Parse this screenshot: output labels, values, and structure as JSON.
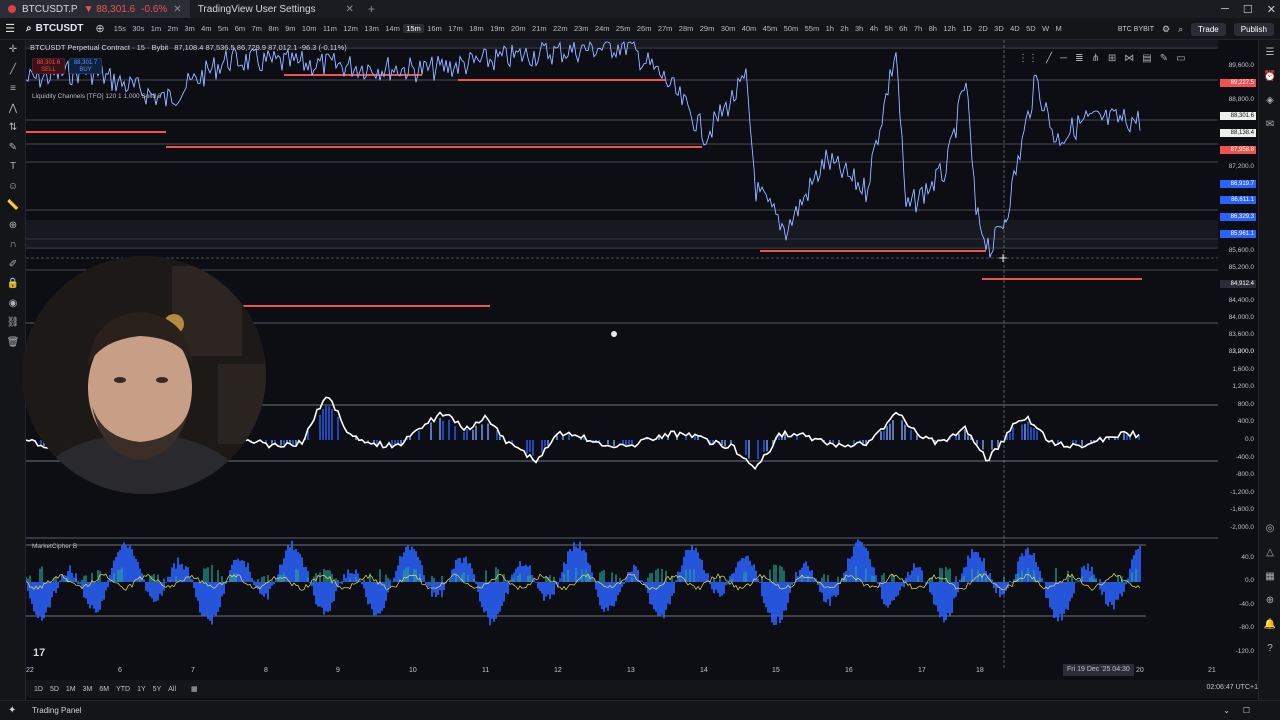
{
  "tabs": [
    {
      "label": "BTCUSDT.P",
      "price": "▼ 88,301.6",
      "change": "-0.6%"
    },
    {
      "label": "TradingView User Settings"
    }
  ],
  "toolbar": {
    "symbol": "BTCUSDT",
    "timeframes": [
      "15s",
      "30s",
      "1m",
      "2m",
      "3m",
      "4m",
      "5m",
      "6m",
      "7m",
      "8m",
      "9m",
      "10m",
      "11m",
      "12m",
      "13m",
      "14m",
      "15m",
      "16m",
      "17m",
      "18m",
      "19m",
      "20m",
      "21m",
      "22m",
      "23m",
      "24m",
      "25m",
      "26m",
      "27m",
      "28m",
      "29m",
      "30m",
      "40m",
      "45m",
      "50m",
      "55m",
      "1h",
      "2h",
      "3h",
      "4h",
      "5h",
      "6h",
      "7h",
      "8h",
      "12h",
      "1D",
      "2D",
      "3D",
      "4D",
      "5D",
      "W",
      "M"
    ],
    "selected_timeframe": "15m",
    "account": "BTC BYBIT",
    "trade_label": "Trade",
    "publish_label": "Publish"
  },
  "chart_header": {
    "title": "BTCUSDT Perpetual Contract · 15 · Bybit",
    "ohlc": "87,108.4  87,536.5  86,729.9  87,012.1  -96.3 (-0.11%)",
    "sell_price": "88,301.6",
    "sell_label": "SELL",
    "buy_price": "88,301.7",
    "buy_label": "BUY",
    "indicator1": "Liquidity Channels [TFO] 120 1 1,000 Solid 3",
    "indicator3": "MarketCipher B"
  },
  "price_axis": [
    "89,600.0",
    "89,227.5",
    "88,800.0",
    "88,301.6",
    "88,138.4",
    "87,958.8",
    "87,200.0",
    "86,919.7",
    "86,611.1",
    "86,329.3",
    "85,961.1",
    "85,600.0",
    "85,200.0",
    "84,912.4",
    "84,400.0",
    "84,000.0",
    "83,600.0",
    "83,200.0"
  ],
  "osc_axis": [
    "2,000.0",
    "1,600.0",
    "1,200.0",
    "800.0",
    "400.0",
    "0.0",
    "-400.0",
    "-800.0",
    "-1,200.0",
    "-1,600.0",
    "-2,000.0"
  ],
  "mcb_axis": [
    "40.0",
    "0.0",
    "-40.0",
    "-80.0",
    "-120.0"
  ],
  "time_axis": [
    "6",
    "7",
    "8",
    "9",
    "10",
    "11",
    "12",
    "13",
    "14",
    "15",
    "16",
    "17",
    "18",
    "Fri 19 Dec '25  04:30",
    "20",
    "21",
    "22"
  ],
  "ranges": [
    "1D",
    "5D",
    "1M",
    "3M",
    "6M",
    "YTD",
    "1Y",
    "5Y",
    "All"
  ],
  "clock": "02:06:47 UTC+1",
  "trading_panel": "Trading Panel",
  "colors": {
    "bg": "#0c0e13",
    "red": "#ef5350",
    "blue": "#2962ff",
    "green": "#26a69a"
  }
}
